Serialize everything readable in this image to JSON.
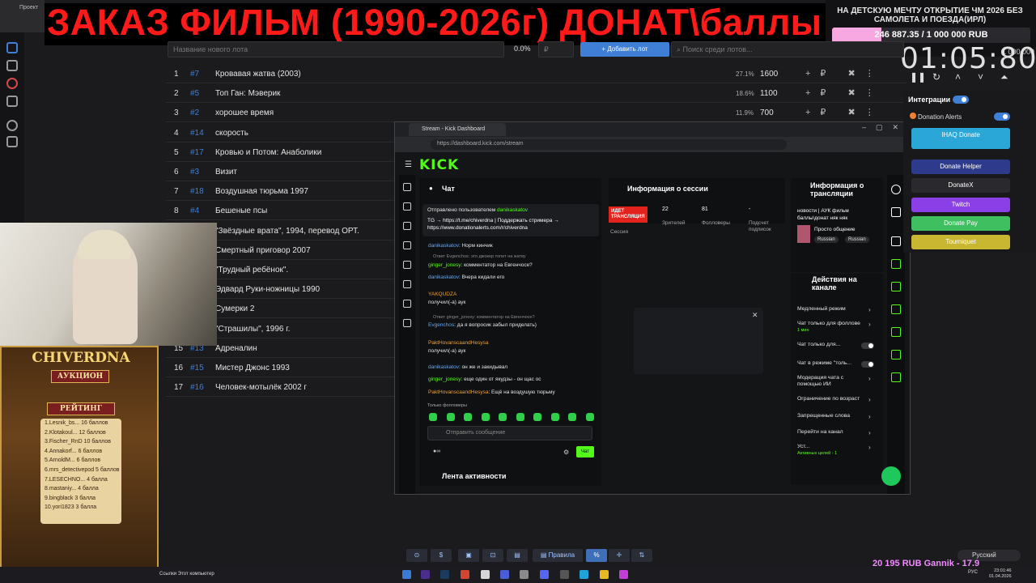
{
  "browser_tab": "Проект",
  "banner": "ЗАКАЗ ФИЛЬМ (1990-2026г) ДОНАТ\\баллы",
  "goal": {
    "title": "НА ДЕТСКУЮ МЕЧТУ ОТКРЫТИЕ ЧМ 2026 БЕЗ САМОЛЕТА И ПОЕЗДА(ИРЛ)",
    "progress_text": "246 887.35 / 1 000 000 RUB",
    "progress_fraction": 0.247,
    "min": "0",
    "max": "1 000 000",
    "fill_color": "#f7a8e0"
  },
  "timer": "01:05:80",
  "lot_input": {
    "name_placeholder": "Название нового лота",
    "percent": "0.0%",
    "amount_placeholder": "₽",
    "add_button": "Добавить лот",
    "search_placeholder": "Поиск среди лотов..."
  },
  "lots": [
    {
      "n": "1",
      "id": "#7",
      "name": "Кровавая жатва (2003)",
      "pct": "27.1%",
      "amt": "1600"
    },
    {
      "n": "2",
      "id": "#5",
      "name": "Топ Ган: Мэверик",
      "pct": "18.6%",
      "amt": "1100"
    },
    {
      "n": "3",
      "id": "#2",
      "name": "хорошее время",
      "pct": "11.9%",
      "amt": "700"
    },
    {
      "n": "4",
      "id": "#14",
      "name": "скорость",
      "pct": "",
      "amt": ""
    },
    {
      "n": "5",
      "id": "#17",
      "name": "Кровью и Потом: Анаболики",
      "pct": "",
      "amt": ""
    },
    {
      "n": "6",
      "id": "#3",
      "name": "Визит",
      "pct": "",
      "amt": ""
    },
    {
      "n": "7",
      "id": "#18",
      "name": "Воздушная тюрьма 1997",
      "pct": "",
      "amt": ""
    },
    {
      "n": "8",
      "id": "#4",
      "name": "Бешеные псы",
      "pct": "",
      "amt": ""
    },
    {
      "n": "",
      "id": "",
      "name": "\"Звёздные врата\", 1994, перевод ОРТ.",
      "pct": "",
      "amt": ""
    },
    {
      "n": "",
      "id": "",
      "name": "Смертный приговор 2007",
      "pct": "",
      "amt": ""
    },
    {
      "n": "",
      "id": "",
      "name": "\"Трудный ребёнок\".",
      "pct": "",
      "amt": ""
    },
    {
      "n": "",
      "id": "",
      "name": "Эдвард Руки-ножницы 1990",
      "pct": "",
      "amt": ""
    },
    {
      "n": "",
      "id": "",
      "name": "Сумерки 2",
      "pct": "",
      "amt": ""
    },
    {
      "n": "",
      "id": "",
      "name": "\"Страшилы\", 1996 г.",
      "pct": "",
      "amt": ""
    },
    {
      "n": "15",
      "id": "#13",
      "name": "Адреналин",
      "pct": "",
      "amt": ""
    },
    {
      "n": "16",
      "id": "#15",
      "name": "Мистер Джонс 1993",
      "pct": "",
      "amt": ""
    },
    {
      "n": "17",
      "id": "#16",
      "name": "Человек-мотылёк 2002 г",
      "pct": "",
      "amt": ""
    }
  ],
  "rating": {
    "title": "CHIVERDNA",
    "subtitle": "АУКЦИОН",
    "heading": "РЕЙТИНГ",
    "entries": [
      "1.Lesnik_bs... 16 баллов",
      "2.Klotakoul... 12 баллов",
      "3.Fischer_RnD 10 баллов",
      "4.Annakorf... 6 баллов",
      "5.ArnoldM... 6 баллов",
      "6.mrs_detectivepod 5 баллов",
      "7.LESECHNO... 4 балла",
      "8.mastaniy... 4 балла",
      "9.bingblack 3 балла",
      "10.yori1823 3 балла"
    ]
  },
  "kick": {
    "tab_title": "Stream - Kick Dashboard",
    "url": "https://dashboard.kick.com/stream",
    "logo": "KICK",
    "chat_title": "Чат",
    "pinned_by": "Отправлено пользователем",
    "pinned_user": "danikaskatov",
    "pinned_text": "TG → https://t.me/chiverdna | Поддержать стримера → https://www.donationalerts.com/r/chiverdna",
    "messages": [
      {
        "user": "danikaskatov",
        "text": ": Норм кинчик"
      },
      {
        "reply": "Ответ Evgenchos: это джокер топит на жатву"
      },
      {
        "user": "ginger_jonesy",
        "text": ": комментатор на Евгенчосе?"
      },
      {
        "user": "danikaskatov",
        "text": ": Вчера кидали его"
      },
      {
        "user": "YAKQUDZA",
        "text": "получил(-а) аук"
      },
      {
        "reply": "Ответ ginger_jonesy: комментатор на Евгенчосе?"
      },
      {
        "user": "Evgenchos",
        "text": ": да я вопросик забыл приделать)"
      },
      {
        "user": "PaktHovanscaandHesysa",
        "text": "получил(-а) аук"
      },
      {
        "user": "danikaskatov",
        "text": ": он же и закидывал"
      },
      {
        "user": "ginger_jonesy",
        "text": ": еще один от якудзы - он щас ос"
      },
      {
        "user": "PaktHovanscaandHesysa",
        "text": ": Ещё на воздушую тюрьму"
      }
    ],
    "followers_only": "Только фолловеры",
    "input_placeholder": "Отправить сообщение",
    "chat_button": "Чат",
    "feed_title": "Лента активности",
    "session_title": "Информация о сессии",
    "live_badge": "ИДЕТ ТРАНСЛЯЦИЯ",
    "session_label": "Сессия",
    "viewers": "22",
    "viewers_label": "Зрителей",
    "followers": "81",
    "followers_label": "Фолловеры",
    "subs": "-",
    "subs_label": "Подсчет подписок",
    "stream_title": "Информация о трансляции",
    "stream_name": "новости | АУК фильм баллы\\донат няк няк",
    "category": "Просто общение",
    "tag1": "Russian",
    "tag2": "Russian",
    "actions_title": "Действия на канале",
    "actions": [
      {
        "label": "Медленный режим",
        "sub": ""
      },
      {
        "label": "Чат только для фоллове",
        "sub": "1 мин"
      },
      {
        "label": "Чат только для...",
        "sub": ""
      },
      {
        "label": "Чат в режиме \"толь...",
        "sub": ""
      },
      {
        "label": "Модерация чата с помощью ИИ",
        "sub": ""
      },
      {
        "label": "Ограничение по возраст",
        "sub": ""
      },
      {
        "label": "Запрещенные слова",
        "sub": ""
      },
      {
        "label": "Перейти на канал",
        "sub": ""
      },
      {
        "label": "Уст...",
        "sub": "Активных целей - 1"
      }
    ]
  },
  "integrations": {
    "title": "Интеграции",
    "donation_alerts": "Donation Alerts",
    "buttons": [
      {
        "label": "IHAQ Donate",
        "color": "#2aa7d6"
      },
      {
        "label": "Donate Helper",
        "color": "#2e3a8c"
      },
      {
        "label": "DonateX",
        "color": "#2a2a2e"
      },
      {
        "label": "Twitch",
        "color": "#8b3fe6"
      },
      {
        "label": "Donate Pay",
        "color": "#3fbf5f"
      },
      {
        "label": "Tourniquet",
        "color": "#c9b631"
      }
    ]
  },
  "toolbar": {
    "rules": "Правила"
  },
  "taskbar": {
    "left_text": "Ссылки   Этот компьютер",
    "lang": "Русский",
    "ticker": "20 195 RUB       Gannik - 17.9",
    "time": "23:01:46",
    "date": "01.04.2026",
    "kb": "РУС"
  }
}
